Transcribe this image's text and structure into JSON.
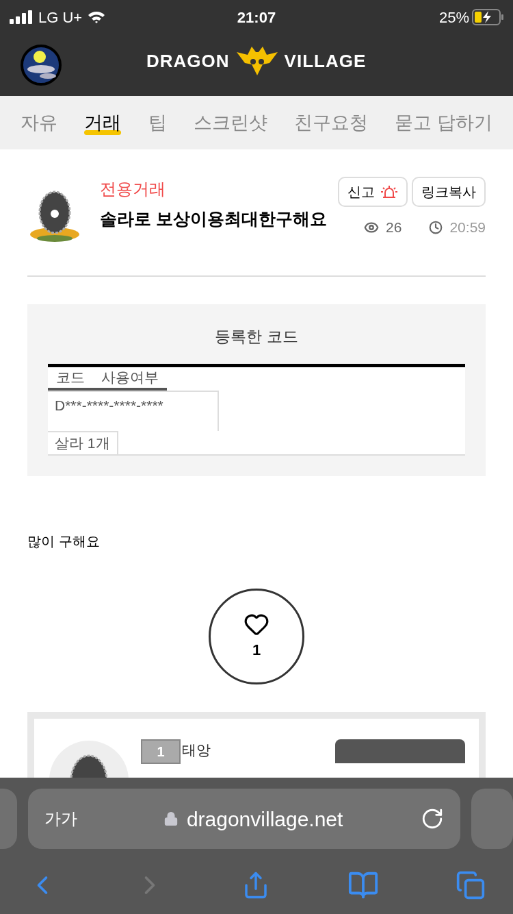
{
  "status_bar": {
    "carrier": "LG U+",
    "time": "21:07",
    "battery": "25%"
  },
  "header": {
    "logo_left": "DRAGON",
    "logo_right": "VILLAGE"
  },
  "tabs": [
    {
      "label": "자유",
      "selected": false
    },
    {
      "label": "거래",
      "selected": true
    },
    {
      "label": "팁",
      "selected": false
    },
    {
      "label": "스크린샷",
      "selected": false
    },
    {
      "label": "친구요청",
      "selected": false
    },
    {
      "label": "묻고 답하기",
      "selected": false
    }
  ],
  "post": {
    "category": "전용거래",
    "title": "솔라로 보상이용최대한구해요",
    "buttons": [
      {
        "label": "신고",
        "kind": "report"
      },
      {
        "label": "링크복사",
        "kind": "plain"
      }
    ],
    "views": "26",
    "time": "20:59"
  },
  "codes": {
    "title": "등록한 코드",
    "columns": [
      "코드",
      "사용여부"
    ],
    "code": "D***-****-****-****",
    "reward": "살라 1개"
  },
  "body": "많이 구해요",
  "like": {
    "count": "1"
  },
  "comment": {
    "level": "1",
    "name": "태앙"
  },
  "browser": {
    "text_size": "가가",
    "url": "dragonvillage.net"
  }
}
